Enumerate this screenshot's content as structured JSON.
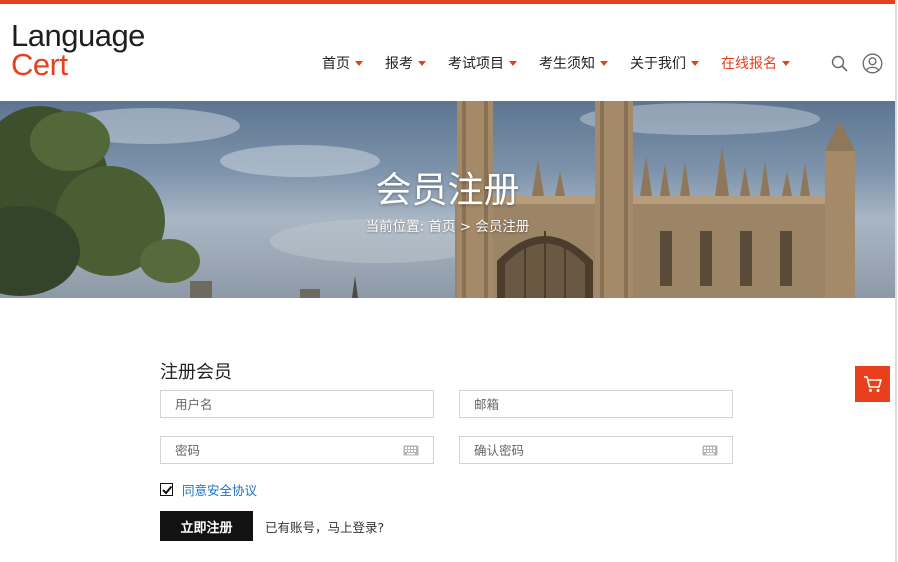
{
  "brand": {
    "line1": "Language",
    "line2": "Cert"
  },
  "nav": {
    "items": [
      {
        "label": "首页",
        "active": false
      },
      {
        "label": "报考",
        "active": false
      },
      {
        "label": "考试项目",
        "active": false
      },
      {
        "label": "考生须知",
        "active": false
      },
      {
        "label": "关于我们",
        "active": false
      },
      {
        "label": "在线报名",
        "active": true
      }
    ],
    "icons": [
      "search-icon",
      "user-icon"
    ]
  },
  "banner": {
    "title": "会员注册",
    "breadcrumb": {
      "prefix": "当前位置:",
      "home": "首页",
      "separator": ">",
      "current": "会员注册"
    }
  },
  "form": {
    "title": "注册会员",
    "username_placeholder": "用户名",
    "email_placeholder": "邮箱",
    "password_placeholder": "密码",
    "confirm_placeholder": "确认密码",
    "agree_label": "同意安全协议",
    "agree_checked": true,
    "submit_label": "立即注册",
    "login_prompt": "已有账号，马上登录?"
  },
  "colors": {
    "accent": "#e8401c",
    "link": "#1a6fc2",
    "button": "#121212"
  },
  "floating": {
    "cart_icon": "cart-icon"
  }
}
